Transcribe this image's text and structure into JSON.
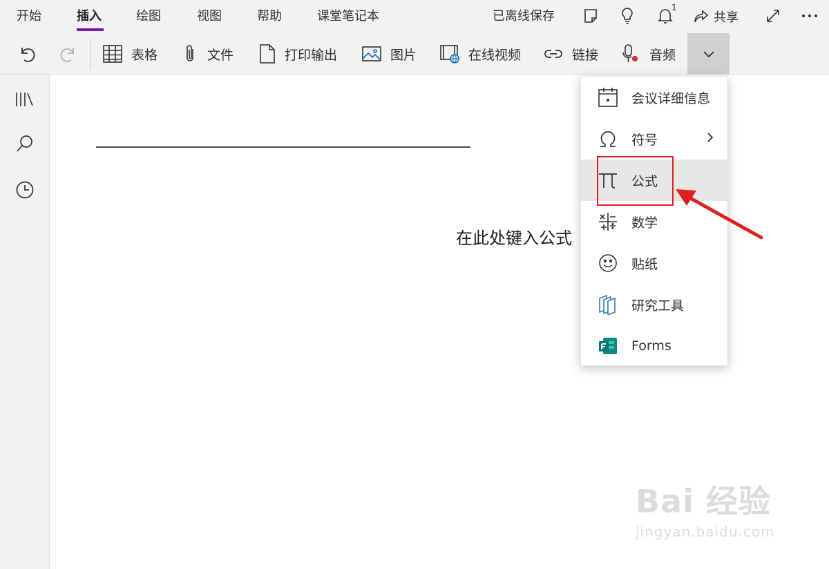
{
  "ribbon": {
    "tabs": [
      "开始",
      "插入",
      "绘图",
      "视图",
      "帮助",
      "课堂笔记本"
    ],
    "active_tab": "插入",
    "status": "已离线保存",
    "notification_count": "1",
    "share_label": "共享",
    "tools": [
      "表格",
      "文件",
      "打印输出",
      "图片",
      "在线视频",
      "链接",
      "音频"
    ]
  },
  "page": {
    "equation_placeholder": "在此处键入公式"
  },
  "menu": {
    "items": [
      {
        "label": "会议详细信息",
        "icon": "calendar-icon"
      },
      {
        "label": "符号",
        "icon": "omega-icon",
        "has_submenu": true
      },
      {
        "label": "公式",
        "icon": "pi-icon",
        "highlighted": true
      },
      {
        "label": "数学",
        "icon": "math-icon"
      },
      {
        "label": "贴纸",
        "icon": "smiley-icon"
      },
      {
        "label": "研究工具",
        "icon": "researcher-icon"
      },
      {
        "label": "Forms",
        "icon": "forms-icon"
      }
    ]
  },
  "watermark": {
    "main": "Bai 经验",
    "sub": "jingyan.baidu.com"
  },
  "colors": {
    "accent": "#7719aa",
    "annotation": "#e02020"
  }
}
